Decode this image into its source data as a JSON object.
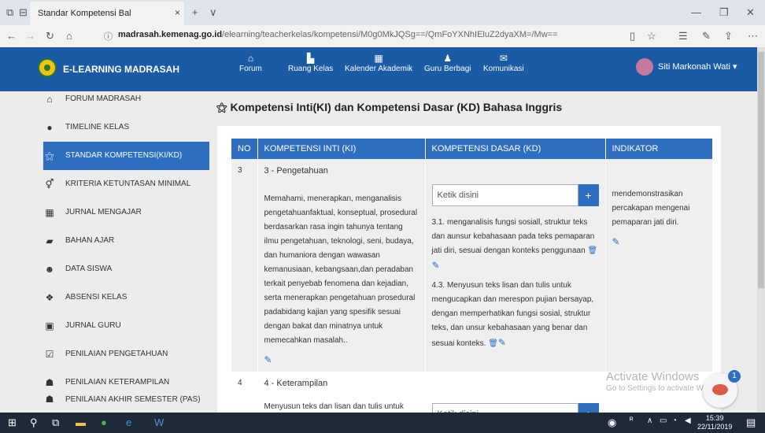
{
  "browser": {
    "tab_title": "Standar Kompetensi Bal",
    "tab_close": "×",
    "new_tab": "+",
    "tab_menu": "∨",
    "url_host": "madrasah.kemenag.go.id",
    "url_path": "/elearning/teacherkelas/kompetensi/M0g0MkJQSg==/QmFoYXNhIEluZ2dyaXM=/Mw=="
  },
  "header": {
    "brand": "E-LEARNING MADRASAH",
    "nav": [
      {
        "label": "Forum",
        "icon": "home-icon"
      },
      {
        "label": "Ruang Kelas",
        "icon": "classroom-icon"
      },
      {
        "label": "Kalender Akademik",
        "icon": "calendar-icon"
      },
      {
        "label": "Guru Berbagi",
        "icon": "teacher-icon"
      },
      {
        "label": "Komunikasi",
        "icon": "mail-icon"
      }
    ],
    "user": "Siti Markonah Wati"
  },
  "sidebar": {
    "items": [
      {
        "label": "FORUM MADRASAH",
        "icon": "home-icon"
      },
      {
        "label": "TIMELINE KELAS",
        "icon": "github-icon"
      },
      {
        "label": "STANDAR KOMPETENSI(KI/KD)",
        "icon": "wand-icon",
        "active": true
      },
      {
        "label": "KRITERIA KETUNTASAN MINIMAL",
        "icon": "gender-icon"
      },
      {
        "label": "JURNAL MENGAJAR",
        "icon": "calendar-icon"
      },
      {
        "label": "BAHAN AJAR",
        "icon": "folder-icon"
      },
      {
        "label": "DATA SISWA",
        "icon": "users-icon"
      },
      {
        "label": "ABSENSI KELAS",
        "icon": "handshake-icon"
      },
      {
        "label": "JURNAL GURU",
        "icon": "calendar-plus-icon"
      },
      {
        "label": "PENILAIAN PENGETAHUAN",
        "icon": "checkbox-icon"
      },
      {
        "label": "PENILAIAN KETERAMPILAN",
        "icon": "group-icon"
      },
      {
        "label": "PENILAIAN AKHIR SEMESTER (PAS)",
        "icon": "user-icon"
      }
    ]
  },
  "main": {
    "title": "Kompetensi Inti(KI) dan Kompetensi Dasar (KD) Bahasa Inggris",
    "table": {
      "headers": [
        "NO",
        "KOMPETENSI INTI (KI)",
        "KOMPETENSI DASAR (KD)",
        "INDIKATOR"
      ],
      "rows": [
        {
          "no": "3",
          "ki_title": "3 - Pengetahuan",
          "ki_desc": "Memahami, menerapkan, menganalisis pengetahuanfaktual, konseptual, prosedural berdasarkan rasa ingin tahunya tentang ilmu pengetahuan, teknologi, seni, budaya, dan humaniora dengan wawasan kemanusiaan, kebangsaan,dan peradaban terkait penyebab fenomena dan kejadian, serta menerapkan pengetahuan prosedural padabidang kajian yang spesifik sesuai dengan bakat dan minatnya untuk memecahkan masalah..",
          "kd_placeholder": "Ketik disini",
          "kd_items": [
            "3.1. menganalisis fungsi sosiall, struktur teks dan aunsur kebahasaan pada teks pemaparan jati diri, sesuai dengan konteks penggunaan",
            "4.3. Menyusun teks lisan dan tulis untuk mengucapkan dan merespon pujian bersayap, dengan memperhatikan fungsi sosial, struktur teks, dan unsur kebahasaan yang benar dan sesuai konteks."
          ],
          "indikator": "mendemonstrasikan percakapan mengenai pemaparan jati diri."
        },
        {
          "no": "4",
          "ki_title": "4 - Keterampilan",
          "ki_desc": "Menyusun teks dan lisan dan tulis untuk",
          "kd_placeholder": "Ketik disini"
        }
      ]
    }
  },
  "overlay": {
    "watermark_title": "Activate Windows",
    "watermark_sub": "Go to Settings to activate Windows.",
    "chat_badge": "1"
  },
  "taskbar": {
    "time": "15:39",
    "date": "22/11/2019"
  }
}
